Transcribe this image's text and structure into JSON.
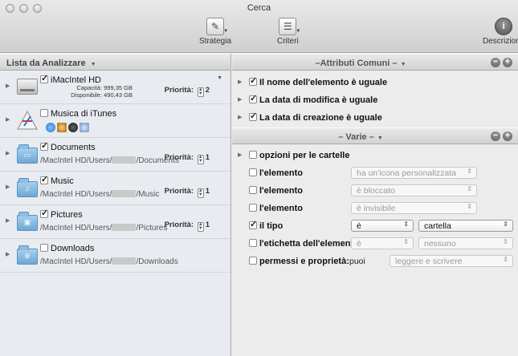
{
  "window": {
    "title": "Cerca"
  },
  "toolbar": {
    "strategia": "Strategia",
    "criteri": "Criteri",
    "descrizione": "Descrizione"
  },
  "left": {
    "header": "Lista da Analizzare",
    "items": [
      {
        "name": "iMacIntel HD",
        "checked": true,
        "capacity": "Capacità: 999,35 GB",
        "available": "Disponibile: 490,43 GB",
        "priority_label": "Priorità:",
        "priority": "2"
      },
      {
        "name": "Musica di iTunes",
        "checked": false
      },
      {
        "name": "Documents",
        "checked": true,
        "path_start": "/MacIntel HD/Users/",
        "path_end": "/Documents",
        "priority_label": "Priorità:",
        "priority": "1"
      },
      {
        "name": "Music",
        "checked": true,
        "path_start": "/MacIntel HD/Users/",
        "path_end": "/Music",
        "priority_label": "Priorità:",
        "priority": "1"
      },
      {
        "name": "Pictures",
        "checked": true,
        "path_start": "/MacIntel HD/Users/",
        "path_end": "/Pictures",
        "priority_label": "Priorità:",
        "priority": "1"
      },
      {
        "name": "Downloads",
        "checked": false,
        "path_start": "/MacIntel HD/Users/",
        "path_end": "/Downloads"
      }
    ]
  },
  "right": {
    "common_header": "–Attributi Comuni –",
    "common": [
      {
        "label": "Il nome dell'elemento è uguale"
      },
      {
        "label": "La data di modifica è uguale"
      },
      {
        "label": "La data di creazione è uguale"
      }
    ],
    "misc_header": "– Varie –",
    "misc": {
      "folders": "opzioni per le cartelle",
      "rows": [
        {
          "label": "l'elemento",
          "value": "ha un'icona personalizzata"
        },
        {
          "label": "l'elemento",
          "value": "è bloccato"
        },
        {
          "label": "l'elemento",
          "value": "è invisibile"
        }
      ],
      "type": {
        "label": "il tipo",
        "op": "è",
        "value": "cartella"
      },
      "tag": {
        "label": "l'etichetta dell'elemento",
        "op": "è",
        "value": "nessuno"
      },
      "perm": {
        "label": "permessi e proprietà:",
        "text": "puoi",
        "value": "leggere e scrivere"
      }
    }
  }
}
